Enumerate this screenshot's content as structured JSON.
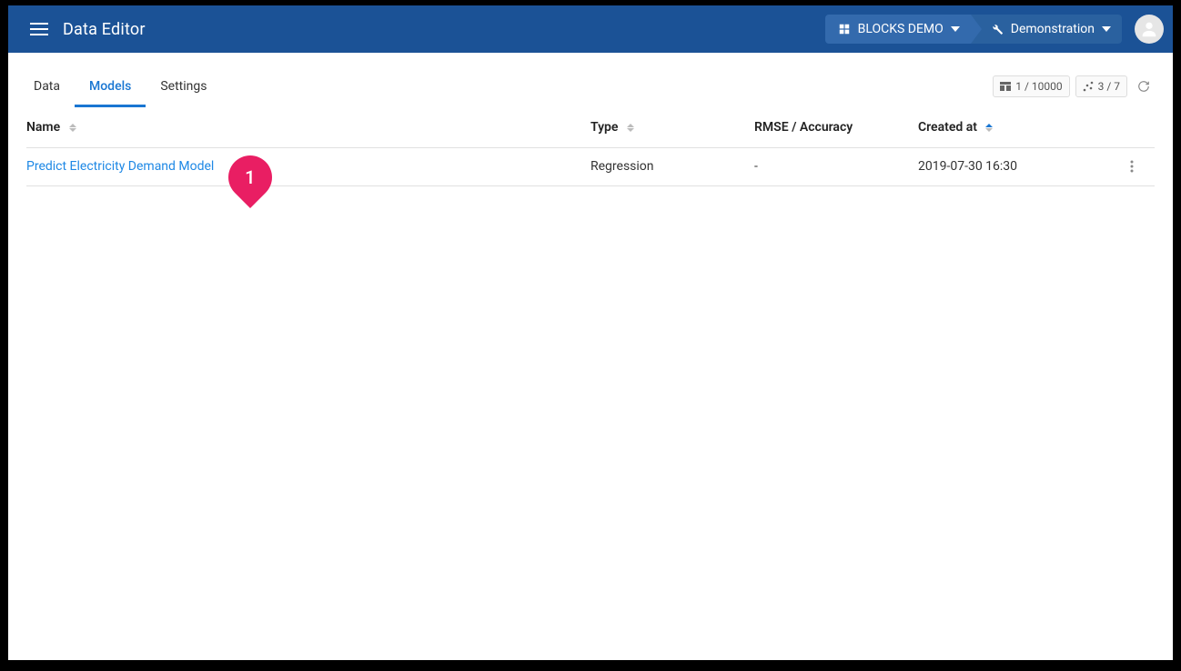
{
  "header": {
    "title": "Data Editor",
    "breadcrumb": {
      "org": "BLOCKS DEMO",
      "project": "Demonstration"
    }
  },
  "tabs": {
    "items": [
      "Data",
      "Models",
      "Settings"
    ],
    "active": 1
  },
  "status": {
    "rows": "1 / 10000",
    "models": "3 / 7"
  },
  "table": {
    "columns": {
      "name": "Name",
      "type": "Type",
      "rmse": "RMSE / Accuracy",
      "created": "Created at"
    },
    "rows": [
      {
        "name": "Predict Electricity Demand Model",
        "type": "Regression",
        "rmse": "-",
        "created": "2019-07-30 16:30"
      }
    ]
  },
  "annotation": {
    "number": "1"
  }
}
